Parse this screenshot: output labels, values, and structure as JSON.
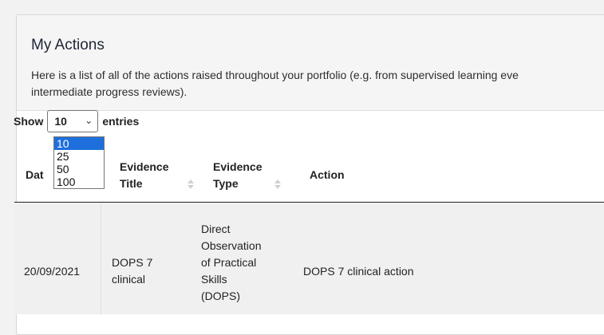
{
  "panel": {
    "title": "My Actions",
    "description": "Here is a list of all of the actions raised throughout your portfolio (e.g. from supervised learning eve\nintermediate progress reviews)."
  },
  "entries": {
    "show_label": "Show",
    "selected": "10",
    "entries_label": "entries",
    "options": [
      "10",
      "25",
      "50",
      "100"
    ]
  },
  "table": {
    "headers": {
      "date": "Dat",
      "evidence_title": "Evidence\nTitle",
      "evidence_type": "Evidence\nType",
      "action": "Action"
    },
    "rows": [
      {
        "date": "20/09/2021",
        "evidence_title": "DOPS 7\nclinical",
        "evidence_type": "Direct\nObservation\nof Practical\nSkills\n(DOPS)",
        "action": "DOPS 7 clinical action"
      }
    ]
  }
}
